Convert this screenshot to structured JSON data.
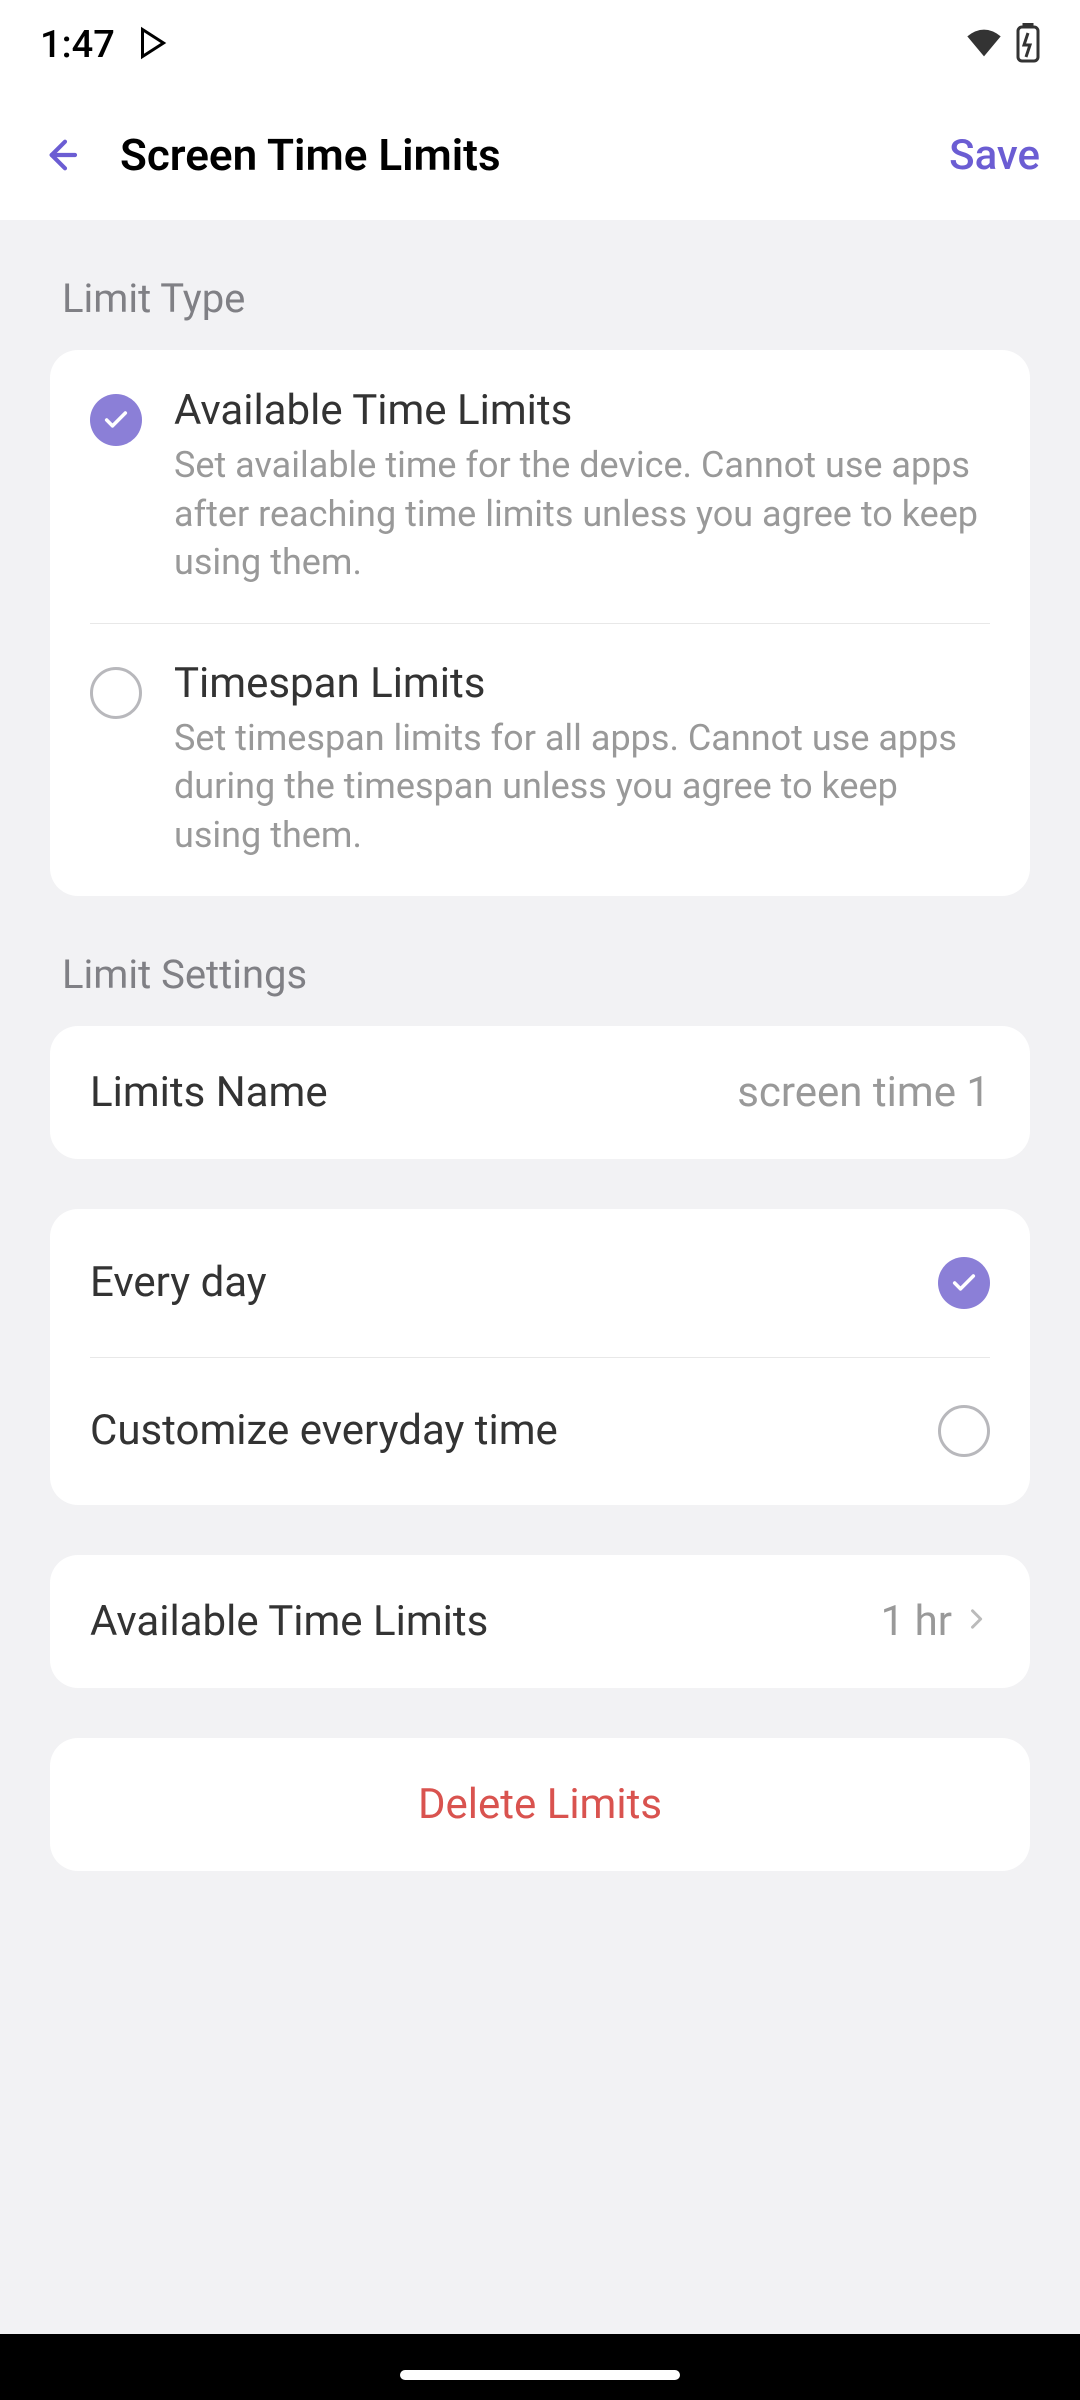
{
  "status": {
    "time": "1:47"
  },
  "header": {
    "title": "Screen Time Limits",
    "save_label": "Save"
  },
  "sections": {
    "limit_type": {
      "label": "Limit Type",
      "options": [
        {
          "title": "Available Time Limits",
          "desc": "Set available time for the device. Cannot use apps after reaching time limits unless you agree to keep using them.",
          "selected": true
        },
        {
          "title": "Timespan Limits",
          "desc": "Set timespan limits for all apps. Cannot use apps during the timespan unless you agree to keep using them.",
          "selected": false
        }
      ]
    },
    "limit_settings": {
      "label": "Limit Settings",
      "name_label": "Limits Name",
      "name_value": "screen time 1"
    },
    "schedule": {
      "everyday_label": "Every day",
      "everyday_selected": true,
      "customize_label": "Customize everyday time",
      "customize_selected": false
    },
    "available_time": {
      "label": "Available Time Limits",
      "value": "1 hr"
    },
    "delete": {
      "label": "Delete Limits"
    }
  },
  "colors": {
    "accent": "#8b7fd7",
    "save": "#6b5dd3",
    "danger": "#d9534f"
  }
}
